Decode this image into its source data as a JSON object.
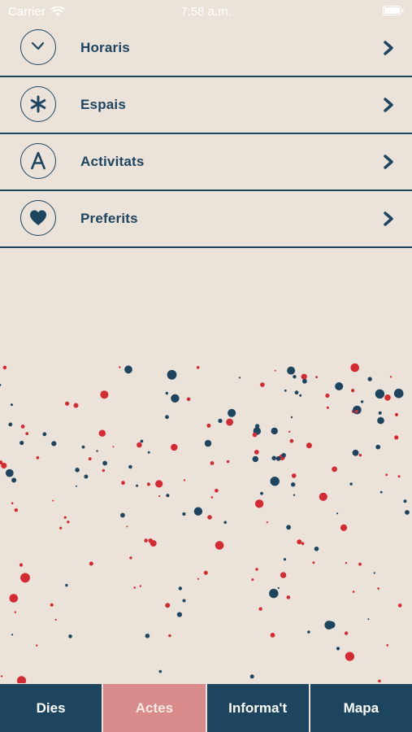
{
  "status": {
    "carrier": "Carrier",
    "time": "7:58 a.m."
  },
  "menu": [
    {
      "label": "Horaris",
      "icon": "clock-icon"
    },
    {
      "label": "Espais",
      "icon": "asterisk-icon"
    },
    {
      "label": "Activitats",
      "icon": "letter-a-icon"
    },
    {
      "label": "Preferits",
      "icon": "heart-icon"
    }
  ],
  "tabs": [
    {
      "label": "Dies",
      "active": false
    },
    {
      "label": "Actes",
      "active": true
    },
    {
      "label": "Informa't",
      "active": false
    },
    {
      "label": "Mapa",
      "active": false
    }
  ],
  "colors": {
    "background": "#ebe3d9",
    "navy": "#1d4560",
    "red": "#d42a33",
    "active_tab": "#d98a8a"
  }
}
